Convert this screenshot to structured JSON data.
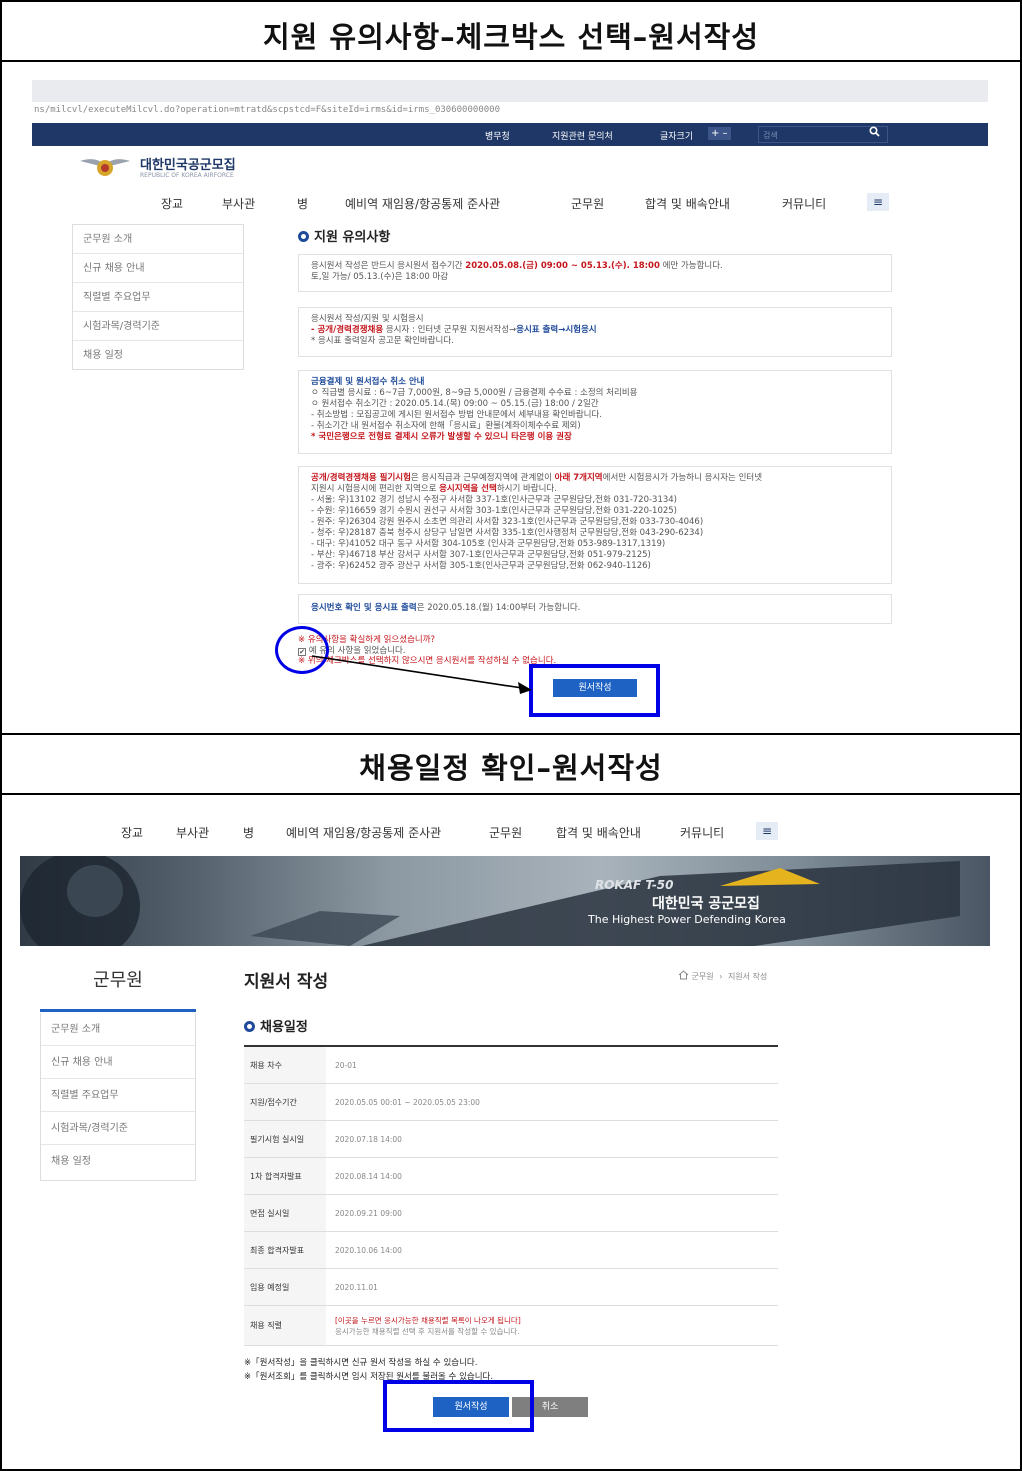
{
  "sections": {
    "top_title": "지원 유의사항–체크박스 선택–원서작성",
    "bottom_title": "채용일정 확인–원서작성"
  },
  "browser": {
    "url": "ns/milcvl/executeMilcvl.do?operation=mtratd&scpstcd=F&siteId=irms&id=irms_030600000000"
  },
  "util_bar": {
    "links": [
      "병무청",
      "지원관련 문의처",
      "글자크기"
    ],
    "font_controls": "+ –",
    "search_placeholder": "검색",
    "search_icon": "magnifier-icon"
  },
  "logo": {
    "name": "대한민국공군모집",
    "sub": "REPUBLIC OF KOREA AIRFORCE"
  },
  "gnb": [
    "장교",
    "부사관",
    "병",
    "예비역 재임용/항공통제 준사관",
    "군무원",
    "합격 및 배속안내",
    "커뮤니티"
  ],
  "menu_icon": "hamburger-icon",
  "lnb": [
    "군무원 소개",
    "신규 채용 안내",
    "직렬별 주요업무",
    "시험과목/경력기준",
    "채용 일정"
  ],
  "notice": {
    "title": "지원 유의사항",
    "box1": {
      "pre": "응시원서 작성은 반드시 응시원서 접수기간 ",
      "period": "2020.05.08.(금) 09:00 ~ 05.13.(수). 18:00",
      "post": " 에만 가능합니다.",
      "line2": "토,일 가능/ 05.13.(수)은 18:00 마감"
    },
    "box2": {
      "line1": "응시원서 작성/지원 및 시험응시",
      "line2_a": "- 공개/경력경쟁채용",
      "line2_b": " 응시자 : 인터넷 군무원 지원서작성→",
      "line2_c": "응시표 출력→시험응시",
      "line3": "* 응시표 출력일자 공고문 확인바랍니다."
    },
    "box3": {
      "title": "금융결제 및 원서접수 취소 안내",
      "lines": [
        "ㅇ 직급별 응시료 : 6~7급 7,000원, 8~9급 5,000원 / 금융결제 수수료 : 소정의 처리비용",
        "ㅇ 원서접수 취소기간 : 2020.05.14.(목) 09:00 ~ 05.15.(금) 18:00 / 2일간",
        "- 취소방법 : 모집공고에 게시된 원서접수 방법 안내문에서 세부내용 확인바랍니다.",
        "- 취소기간 내 원서접수 취소자에 한해「응시료」환불(계좌이체수수료 제외)"
      ],
      "warn": "* 국민은행으로 전형료 결제시 오류가 발생할 수 있으니 타은행 이용 권장"
    },
    "box4": {
      "a": "공개/경력경쟁채용 필기시험",
      "b": "은 응시직급과 근무예정지역에 관계없이 ",
      "c": "아래 7개지역",
      "d": "에서만 시험응시가 가능하니 응시자는 인터넷",
      "e": "지원시 시험응시에 편리한 지역으로 ",
      "f": "응시지역을 선택",
      "g": "하시기 바랍니다.",
      "regions": [
        "- 서울: 우)13102 경기 성남시 수정구 사서함 337-1호(인사근무과 군무원담당,전화 031-720-3134)",
        "- 수원: 우)16659 경기 수원시 권선구 사서함 303-1호(인사근무과 군무원담당,전화 031-220-1025)",
        "- 원주: 우)26304 강원 원주시 소초면 의관리 사서함 323-1호(인사근무과 군무원담당,전화 033-730-4046)",
        "- 청주: 우)28187 충북 청주시 상당구 남일면 사서함 335-1호(인사행정처 군무원담당,전화 043-290-6234)",
        "- 대구: 우)41052 대구 동구 사서함 304-105호 (인사과 군무원담당,전화 053-989-1317,1319)",
        "- 부산: 우)46718 부산 강서구 사서함 307-1호(인사근무과 군무원담당,전화 051-979-2125)",
        "- 광주: 우)62452 광주 광산구 사서함 305-1호(인사근무과 군무원담당,전화 062-940-1126)"
      ]
    },
    "box5": {
      "a": "응시번호 확인 및 응시표 출력",
      "b": "은 2020.05.18.(월) 14:00부터 가능합니다."
    },
    "confirm_q": "※ 유의사항을 확실하게 읽으셨습니까?",
    "checkbox_label": "예 유의 사항을 읽었습니다.",
    "warning": "※ 위의 체크박스를 선택하지 않으시면 응시원서를 작성하실 수 없습니다.",
    "apply_btn": "원서작성"
  },
  "bottom": {
    "gnb": [
      "장교",
      "부사관",
      "병",
      "예비역 재임용/항공통제 준사관",
      "군무원",
      "합격 및 배속안내",
      "커뮤니티"
    ],
    "banner_title": "대한민국 공군모집",
    "banner_sub": "The Highest Power Defending Korea",
    "banner_jet_text": "ROKAF T-50",
    "side_title": "군무원",
    "lnb": [
      "군무원 소개",
      "신규 채용 안내",
      "직렬별 주요업무",
      "시험과목/경력기준",
      "채용 일정"
    ],
    "page_title": "지원서 작성",
    "breadcrumb_home_icon": "home-icon",
    "breadcrumb": [
      "군무원",
      "지원서 작성"
    ],
    "schedule_title": "채용일정",
    "table": [
      {
        "label": "채용 차수",
        "value": "20-01"
      },
      {
        "label": "지원/접수기간",
        "value": "2020.05.05 00:01 ~ 2020.05.05 23:00"
      },
      {
        "label": "필기시험 실시일",
        "value": "2020.07.18 14:00"
      },
      {
        "label": "1차 합격자발표",
        "value": "2020.08.14 14:00"
      },
      {
        "label": "면접 실시일",
        "value": "2020.09.21 09:00"
      },
      {
        "label": "최종 합격자발표",
        "value": "2020.10.06 14:00"
      },
      {
        "label": "임용 예정일",
        "value": "2020.11.01"
      }
    ],
    "job_label": "채용 직렬",
    "job_link": "[이곳을 누르면 응시가능한 채용직렬 목록이 나오게 됩니다]",
    "job_desc": "응시가능한 채용직렬 선택 후 지원서를 작성할 수 있습니다.",
    "note1": "※「원서작성」을 클릭하시면 신규 원서 작성을 하실 수 있습니다.",
    "note2": "※「원서조회」를 클릭하시면 임시 저장된 원서를 불러올 수 있습니다.",
    "apply_btn": "원서작성",
    "cancel_btn": "취소"
  }
}
